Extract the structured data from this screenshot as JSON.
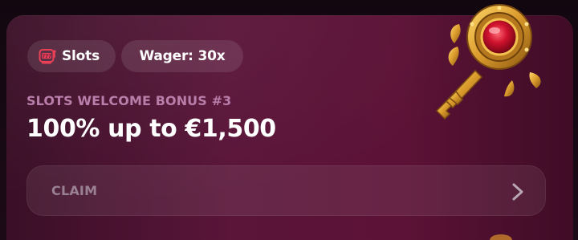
{
  "bonus_card": {
    "tags": {
      "category_label": "Slots",
      "category_icon": "slot-machine-icon",
      "wager_label": "Wager: 30x"
    },
    "subtitle": "SLOTS WELCOME BONUS #3",
    "headline": "100% up to €1,500",
    "claim_button": {
      "label": "CLAIM",
      "icon": "chevron-right-icon"
    },
    "illustration_icon": "golden-key-icon"
  },
  "colors": {
    "card_gradient_start": "#3a0f27",
    "card_gradient_mid": "#5a1539",
    "subtitle": "#b77aa8",
    "headline": "#ffffff",
    "claim_label": "#9a8094",
    "slot_icon": "#e8394f",
    "key_gold": "#d99a2b",
    "key_gem": "#d0122e"
  }
}
